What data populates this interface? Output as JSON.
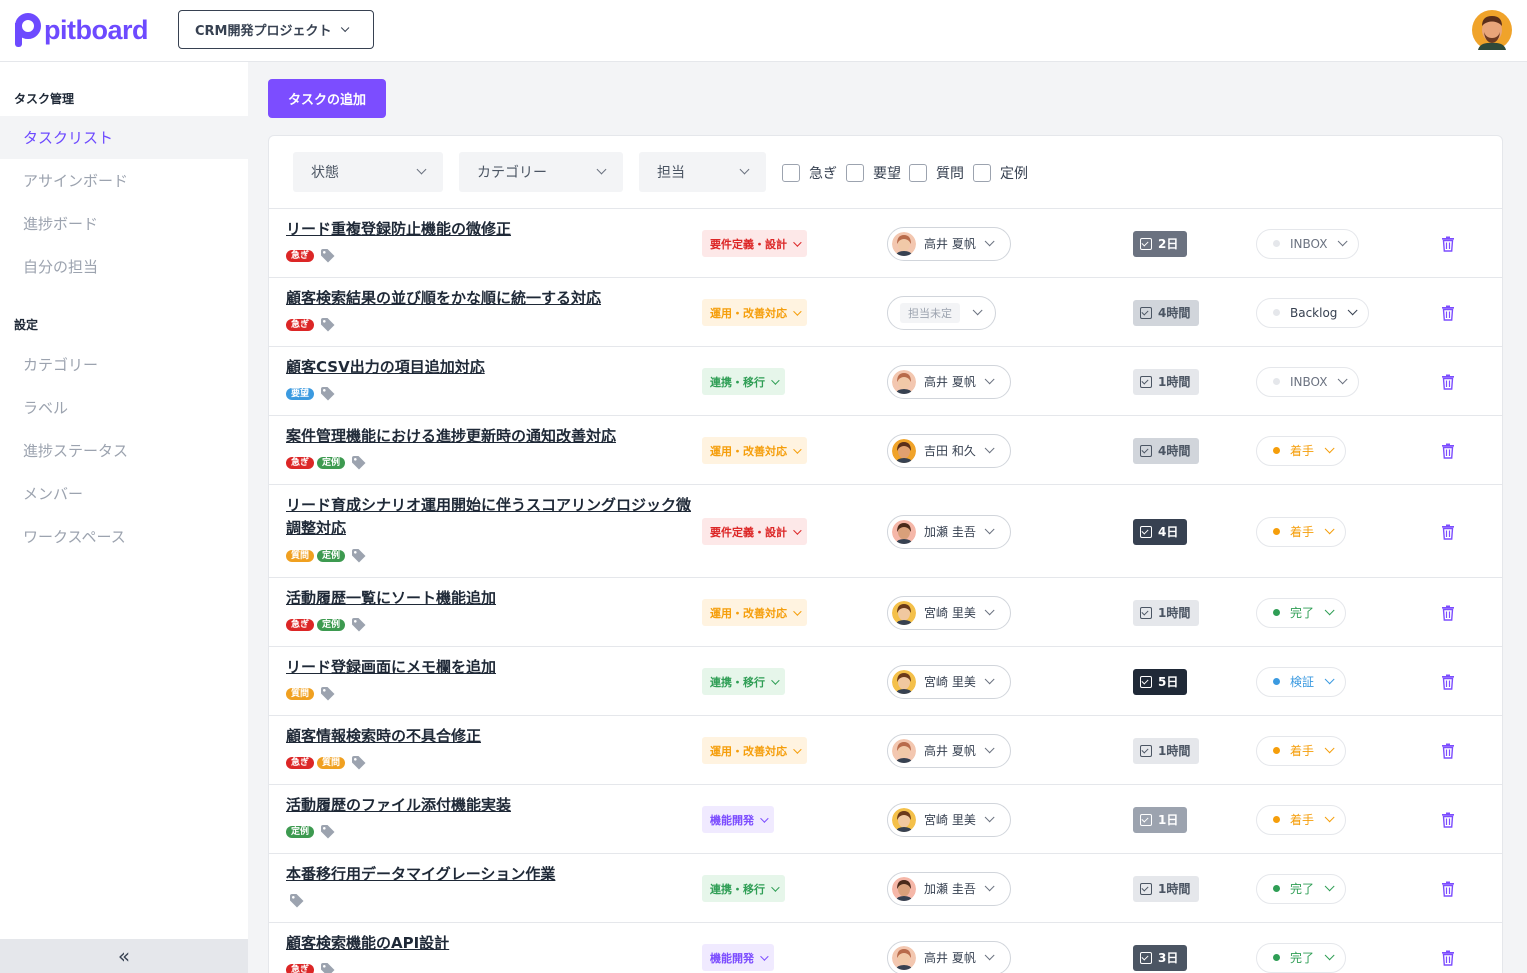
{
  "app": {
    "logo_text": "pitboard",
    "project": "CRM開発プロジェクト"
  },
  "colors": {
    "accent": "#7c4dff"
  },
  "sidebar": {
    "section_task": "タスク管理",
    "task_items": [
      {
        "label": "タスクリスト",
        "active": true
      },
      {
        "label": "アサインボード"
      },
      {
        "label": "進捗ボード"
      },
      {
        "label": "自分の担当"
      }
    ],
    "section_settings": "設定",
    "settings_items": [
      {
        "label": "カテゴリー"
      },
      {
        "label": "ラベル"
      },
      {
        "label": "進捗ステータス"
      },
      {
        "label": "メンバー"
      },
      {
        "label": "ワークスペース"
      }
    ],
    "collapse_icon": "double-chevron-left-icon",
    "collapse_glyph": "«"
  },
  "main": {
    "add_button": "タスクの追加",
    "filters": {
      "status": "状態",
      "category": "カテゴリー",
      "assignee": "担当"
    },
    "checkboxes": [
      "急ぎ",
      "要望",
      "質問",
      "定例"
    ]
  },
  "tasks": [
    {
      "title": "リード重複登録防止機能の微修正",
      "labels": [
        "急ぎ"
      ],
      "category": "要件定義・設計",
      "assignee": "高井 夏帆",
      "estimate": "2日",
      "status": "INBOX"
    },
    {
      "title": "顧客検索結果の並び順をかな順に統一する対応",
      "labels": [
        "急ぎ"
      ],
      "category": "運用・改善対応",
      "assignee": "担当未定",
      "estimate": "4時間",
      "status": "Backlog"
    },
    {
      "title": "顧客CSV出力の項目追加対応",
      "labels": [
        "要望"
      ],
      "category": "連携・移行",
      "assignee": "高井 夏帆",
      "estimate": "1時間",
      "status": "INBOX"
    },
    {
      "title": "案件管理機能における進捗更新時の通知改善対応",
      "labels": [
        "急ぎ",
        "定例"
      ],
      "category": "運用・改善対応",
      "assignee": "吉田 和久",
      "estimate": "4時間",
      "status": "着手"
    },
    {
      "title": "リード育成シナリオ運用開始に伴うスコアリングロジック微調整対応",
      "labels": [
        "質問",
        "定例"
      ],
      "category": "要件定義・設計",
      "assignee": "加瀬 圭吾",
      "estimate": "4日",
      "status": "着手"
    },
    {
      "title": "活動履歴一覧にソート機能追加",
      "labels": [
        "急ぎ",
        "定例"
      ],
      "category": "運用・改善対応",
      "assignee": "宮崎 里美",
      "estimate": "1時間",
      "status": "完了"
    },
    {
      "title": "リード登録画面にメモ欄を追加",
      "labels": [
        "質問"
      ],
      "category": "連携・移行",
      "assignee": "宮崎 里美",
      "estimate": "5日",
      "status": "検証"
    },
    {
      "title": "顧客情報検索時の不具合修正",
      "labels": [
        "急ぎ",
        "質問"
      ],
      "category": "運用・改善対応",
      "assignee": "高井 夏帆",
      "estimate": "1時間",
      "status": "着手"
    },
    {
      "title": "活動履歴のファイル添付機能実装",
      "labels": [
        "定例"
      ],
      "category": "機能開発",
      "assignee": "宮崎 里美",
      "estimate": "1日",
      "status": "着手"
    },
    {
      "title": "本番移行用データマイグレーション作業",
      "labels": [],
      "category": "連携・移行",
      "assignee": "加瀬 圭吾",
      "estimate": "1時間",
      "status": "完了"
    },
    {
      "title": "顧客検索機能のAPI設計",
      "labels": [
        "急ぎ"
      ],
      "category": "機能開発",
      "assignee": "高井 夏帆",
      "estimate": "3日",
      "status": "完了"
    }
  ]
}
